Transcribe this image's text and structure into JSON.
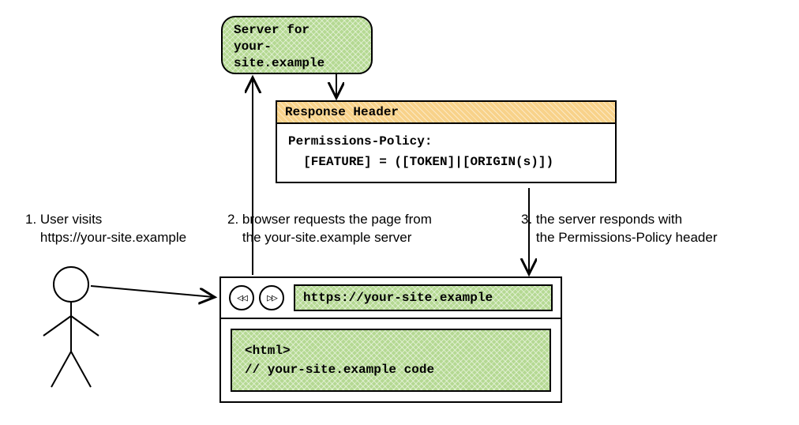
{
  "server": {
    "line1": "Server for",
    "line2": "your-site.example"
  },
  "response_header": {
    "title": "Response Header",
    "line1": "Permissions-Policy:",
    "line2": "  [FEATURE] = ([TOKEN]|[ORIGIN(s)])"
  },
  "captions": {
    "c1_a": "1. User visits",
    "c1_b": "    https://your-site.example",
    "c2_a": "2. browser requests the page from",
    "c2_b": "    the your-site.example server",
    "c3_a": "3. the server responds with",
    "c3_b": "    the Permissions-Policy header"
  },
  "browser": {
    "url": "https://your-site.example",
    "code_line1": "<html>",
    "code_line2": "// your-site.example code"
  }
}
